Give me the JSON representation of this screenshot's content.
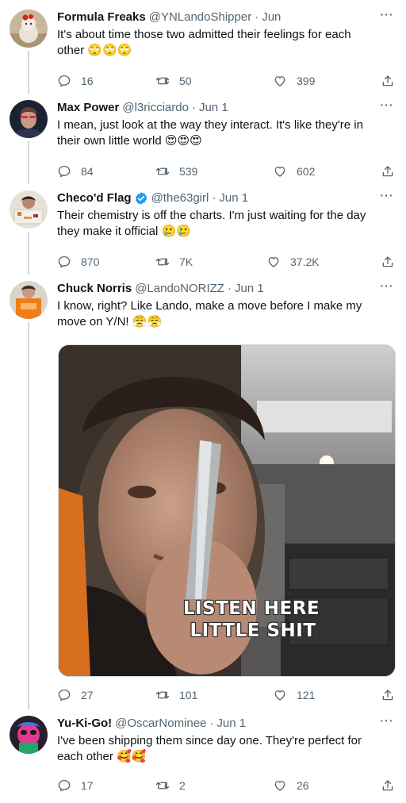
{
  "icons": {
    "reply": "reply-bubble-icon",
    "retweet": "retweet-arrows-icon",
    "like": "heart-icon",
    "share": "share-upload-icon",
    "more": "more-dots-icon",
    "verified": "verified-badge-icon"
  },
  "colors": {
    "text": "#0f1419",
    "muted": "#536471",
    "thread_line": "#cfd9de",
    "verified": "#1d9bf0"
  },
  "tweets": [
    {
      "name": "Formula Freaks",
      "handle": "@YNLandoShipper",
      "date": "Jun",
      "text": "It's about time those two admitted their feelings for each other 🙄🙄🙄",
      "replies": "16",
      "retweets": "50",
      "likes": "399"
    },
    {
      "name": "Max Power",
      "handle": "@l3ricciardo",
      "date": "Jun 1",
      "text": "I mean, just look at the way they interact. It's like they're in their own little world 😍😍😍",
      "replies": "84",
      "retweets": "539",
      "likes": "602"
    },
    {
      "name": "Checo'd Flag",
      "handle": "@the63girl",
      "date": "Jun 1",
      "text": "Their chemistry is off the charts. I'm just waiting for the day they make it official 🥲🥲",
      "replies": "870",
      "retweets": "7K",
      "likes": "37.2K"
    },
    {
      "name": "Chuck Norris",
      "handle": "@LandoNORIZZ",
      "date": "Jun 1",
      "text": "I know, right? Like Lando, make a move before I make my move on Y/N! 😤😤",
      "replies": "27",
      "retweets": "101",
      "likes": "121",
      "media": {
        "caption_line1": "LISTEN HERE",
        "caption_line2": "LITTLE SHIT"
      }
    },
    {
      "name": "Yu-Ki-Go!",
      "handle": "@OscarNominee",
      "date": "Jun 1",
      "text": "I've been shipping them since day one. They're perfect for each other 🥰🥰",
      "replies": "17",
      "retweets": "2",
      "likes": "26"
    }
  ]
}
